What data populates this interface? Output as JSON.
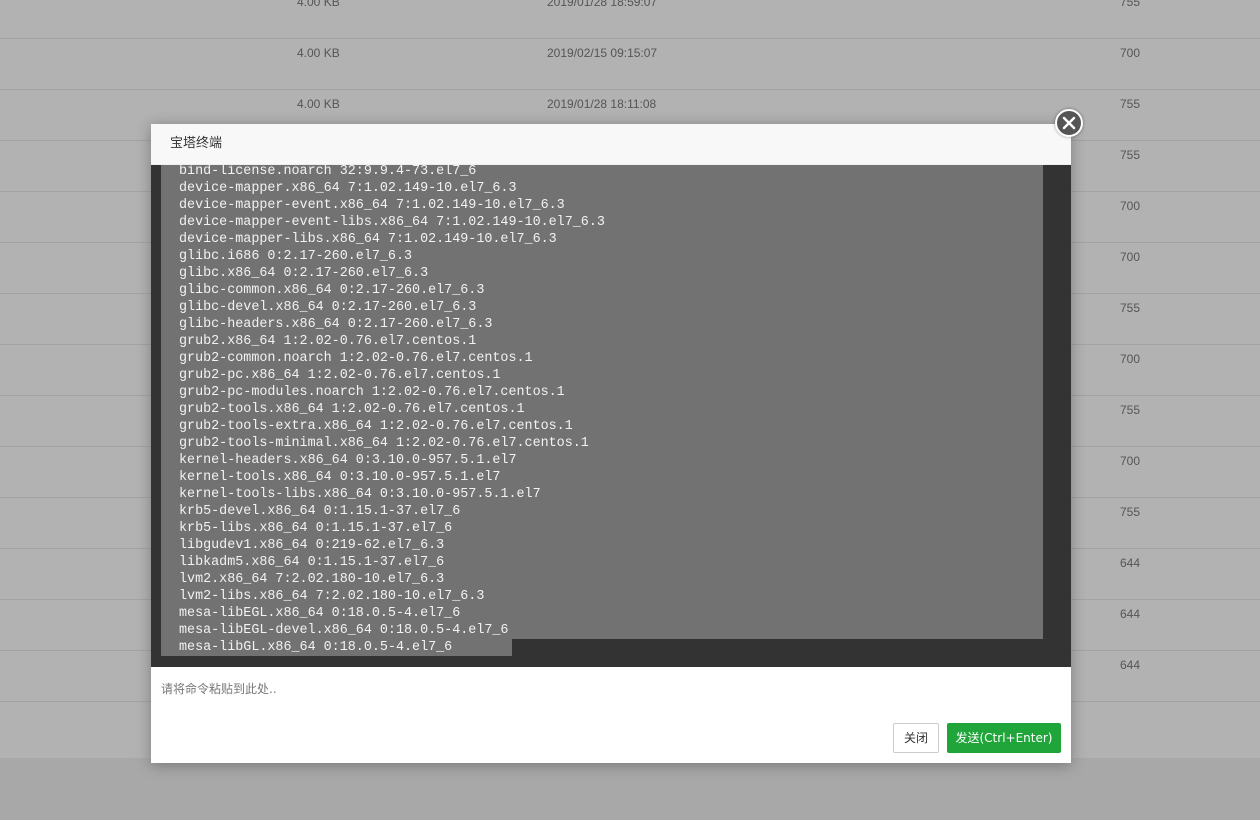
{
  "background_table": {
    "rows": [
      {
        "size": "4.00 KB",
        "date": "2019/01/28 18:59:07",
        "perm": "755"
      },
      {
        "size": "4.00 KB",
        "date": "2019/02/15 09:15:07",
        "perm": "700"
      },
      {
        "size": "4.00 KB",
        "date": "2019/01/28 18:11:08",
        "perm": "755"
      },
      {
        "size": "",
        "date": "",
        "perm": "755"
      },
      {
        "size": "",
        "date": "",
        "perm": "700"
      },
      {
        "size": "",
        "date": "",
        "perm": "700"
      },
      {
        "size": "",
        "date": "",
        "perm": "755"
      },
      {
        "size": "",
        "date": "",
        "perm": "700"
      },
      {
        "size": "",
        "date": "",
        "perm": "755"
      },
      {
        "size": "",
        "date": "",
        "perm": "700"
      },
      {
        "size": "",
        "date": "",
        "perm": "755"
      },
      {
        "size": "",
        "date": "",
        "perm": "644"
      },
      {
        "size": "",
        "date": "",
        "perm": "644"
      },
      {
        "size": "",
        "date": "",
        "perm": "644"
      }
    ]
  },
  "modal": {
    "title": "宝塔终端",
    "close_icon": "close-icon",
    "terminal_lines": [
      "bind-license.noarch 32:9.9.4-73.el7_6",
      "device-mapper.x86_64 7:1.02.149-10.el7_6.3",
      "device-mapper-event.x86_64 7:1.02.149-10.el7_6.3",
      "device-mapper-event-libs.x86_64 7:1.02.149-10.el7_6.3",
      "device-mapper-libs.x86_64 7:1.02.149-10.el7_6.3",
      "glibc.i686 0:2.17-260.el7_6.3",
      "glibc.x86_64 0:2.17-260.el7_6.3",
      "glibc-common.x86_64 0:2.17-260.el7_6.3",
      "glibc-devel.x86_64 0:2.17-260.el7_6.3",
      "glibc-headers.x86_64 0:2.17-260.el7_6.3",
      "grub2.x86_64 1:2.02-0.76.el7.centos.1",
      "grub2-common.noarch 1:2.02-0.76.el7.centos.1",
      "grub2-pc.x86_64 1:2.02-0.76.el7.centos.1",
      "grub2-pc-modules.noarch 1:2.02-0.76.el7.centos.1",
      "grub2-tools.x86_64 1:2.02-0.76.el7.centos.1",
      "grub2-tools-extra.x86_64 1:2.02-0.76.el7.centos.1",
      "grub2-tools-minimal.x86_64 1:2.02-0.76.el7.centos.1",
      "kernel-headers.x86_64 0:3.10.0-957.5.1.el7",
      "kernel-tools.x86_64 0:3.10.0-957.5.1.el7",
      "kernel-tools-libs.x86_64 0:3.10.0-957.5.1.el7",
      "krb5-devel.x86_64 0:1.15.1-37.el7_6",
      "krb5-libs.x86_64 0:1.15.1-37.el7_6",
      "libgudev1.x86_64 0:219-62.el7_6.3",
      "libkadm5.x86_64 0:1.15.1-37.el7_6",
      "lvm2.x86_64 7:2.02.180-10.el7_6.3",
      "lvm2-libs.x86_64 7:2.02.180-10.el7_6.3",
      "mesa-libEGL.x86_64 0:18.0.5-4.el7_6",
      "mesa-libEGL-devel.x86_64 0:18.0.5-4.el7_6",
      "mesa-libGL.x86_64 0:18.0.5-4.el7_6"
    ],
    "command_input": {
      "value": "",
      "placeholder": "请将命令粘贴到此处.."
    },
    "buttons": {
      "close_label": "关闭",
      "send_label": "发送(Ctrl+Enter)"
    }
  },
  "colors": {
    "send_button": "#20a53a",
    "terminal_bg": "#333333",
    "terminal_selection": "#727272"
  }
}
